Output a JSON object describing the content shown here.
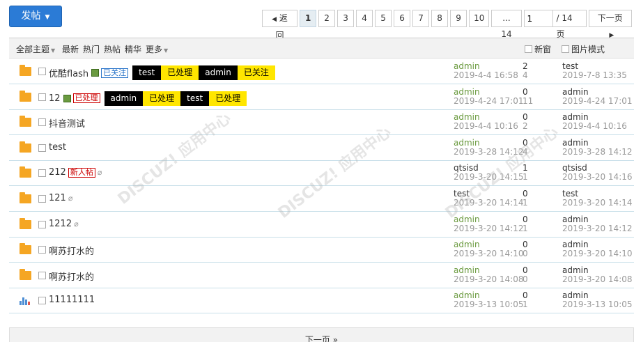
{
  "toolbar": {
    "post_label": "发帖"
  },
  "pager": {
    "back_label": "返回",
    "pages": [
      "1",
      "2",
      "3",
      "4",
      "5",
      "6",
      "7",
      "8",
      "9",
      "10"
    ],
    "last_label": "... 14",
    "current_input": "1",
    "total_label": "/ 14 页",
    "next_label": "下一页"
  },
  "filters": {
    "all": "全部主题",
    "latest": "最新",
    "hot": "热门",
    "hotpost": "热帖",
    "digest": "精华",
    "more": "更多",
    "new_window": "新窗",
    "image_mode": "图片模式"
  },
  "threads": [
    {
      "title": "优酷flash",
      "icon": "folder",
      "has_img": true,
      "tag": "已关注",
      "tag_type": "blue",
      "labels": [
        [
          "test",
          "black"
        ],
        [
          "已处理",
          "yellow"
        ],
        [
          "admin",
          "black"
        ],
        [
          "已关注",
          "yellow"
        ]
      ],
      "author": "admin",
      "date": "2019-4-4 16:58",
      "replies": "2",
      "views": "4",
      "last_user": "test",
      "last_date": "2019-7-8 13:35"
    },
    {
      "title": "12",
      "icon": "folder",
      "has_img": true,
      "tag": "已处理",
      "tag_type": "red",
      "labels": [
        [
          "admin",
          "black"
        ],
        [
          "已处理",
          "yellow"
        ],
        [
          "test",
          "black"
        ],
        [
          "已处理",
          "yellow"
        ]
      ],
      "author": "admin",
      "date": "2019-4-24 17:01",
      "replies": "0",
      "views": "11",
      "last_user": "admin",
      "last_date": "2019-4-24 17:01"
    },
    {
      "title": "抖音测试",
      "icon": "folder",
      "author": "admin",
      "date": "2019-4-4 10:16",
      "replies": "0",
      "views": "2",
      "last_user": "admin",
      "last_date": "2019-4-4 10:16"
    },
    {
      "title": "test",
      "icon": "folder",
      "author": "admin",
      "date": "2019-3-28 14:12",
      "replies": "0",
      "views": "4",
      "last_user": "admin",
      "last_date": "2019-3-28 14:12"
    },
    {
      "title": "212",
      "icon": "folder",
      "tag": "新人帖",
      "tag_type": "red",
      "clip": true,
      "author": "qtsisd",
      "author_plain": true,
      "date": "2019-3-20 14:15",
      "replies": "1",
      "views": "1",
      "last_user": "qtsisd",
      "last_date": "2019-3-20 14:16"
    },
    {
      "title": "121",
      "icon": "folder",
      "clip": true,
      "author": "test",
      "author_plain": true,
      "date": "2019-3-20 14:14",
      "replies": "0",
      "views": "1",
      "last_user": "test",
      "last_date": "2019-3-20 14:14"
    },
    {
      "title": "1212",
      "icon": "folder",
      "clip": true,
      "author": "admin",
      "date": "2019-3-20 14:12",
      "replies": "0",
      "views": "1",
      "last_user": "admin",
      "last_date": "2019-3-20 14:12"
    },
    {
      "title": "啊苏打水的",
      "icon": "folder",
      "author": "admin",
      "date": "2019-3-20 14:10",
      "replies": "0",
      "views": "0",
      "last_user": "admin",
      "last_date": "2019-3-20 14:10"
    },
    {
      "title": "啊苏打水的",
      "icon": "folder",
      "author": "admin",
      "date": "2019-3-20 14:08",
      "replies": "0",
      "views": "0",
      "last_user": "admin",
      "last_date": "2019-3-20 14:08"
    },
    {
      "title": "11111111",
      "icon": "chart",
      "author": "admin",
      "date": "2019-3-13 10:05",
      "replies": "0",
      "views": "1",
      "last_user": "admin",
      "last_date": "2019-3-13 10:05"
    }
  ],
  "bottom": {
    "next_label": "下一页 »"
  },
  "colors": {
    "accent": "#2b7bd6",
    "author_green": "#6a9a3e",
    "label_black": "#000000",
    "label_yellow": "#ffe600"
  }
}
